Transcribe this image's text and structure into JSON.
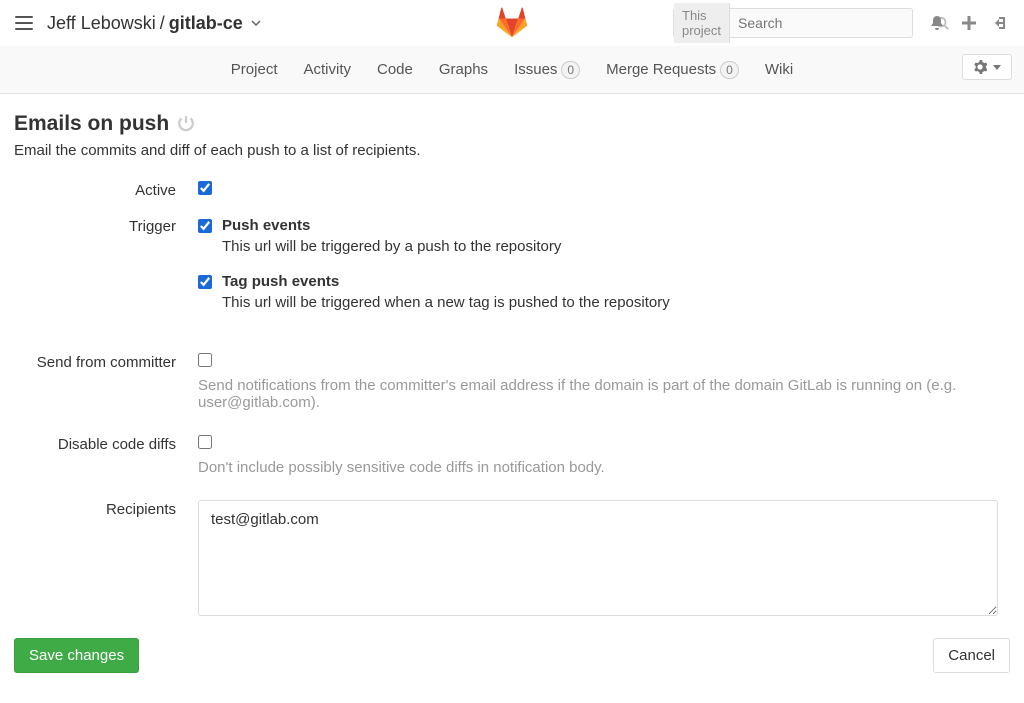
{
  "header": {
    "breadcrumb_owner": "Jeff Lebowski",
    "breadcrumb_project": "gitlab-ce",
    "search_scope": "This project",
    "search_placeholder": "Search"
  },
  "nav": {
    "project": "Project",
    "activity": "Activity",
    "code": "Code",
    "graphs": "Graphs",
    "issues": "Issues",
    "issues_count": "0",
    "merge_requests": "Merge Requests",
    "merge_requests_count": "0",
    "wiki": "Wiki"
  },
  "page": {
    "title": "Emails on push",
    "description": "Email the commits and diff of each push to a list of recipients."
  },
  "form": {
    "active_label": "Active",
    "trigger_label": "Trigger",
    "triggers": [
      {
        "title": "Push events",
        "desc": "This url will be triggered by a push to the repository",
        "checked": true
      },
      {
        "title": "Tag push events",
        "desc": "This url will be triggered when a new tag is pushed to the repository",
        "checked": true
      }
    ],
    "send_from_committer_label": "Send from committer",
    "send_from_committer_help": "Send notifications from the committer's email address if the domain is part of the domain GitLab is running on (e.g. user@gitlab.com).",
    "disable_diffs_label": "Disable code diffs",
    "disable_diffs_help": "Don't include possibly sensitive code diffs in notification body.",
    "recipients_label": "Recipients",
    "recipients_value": "test@gitlab.com",
    "save_button": "Save changes",
    "cancel_button": "Cancel"
  }
}
